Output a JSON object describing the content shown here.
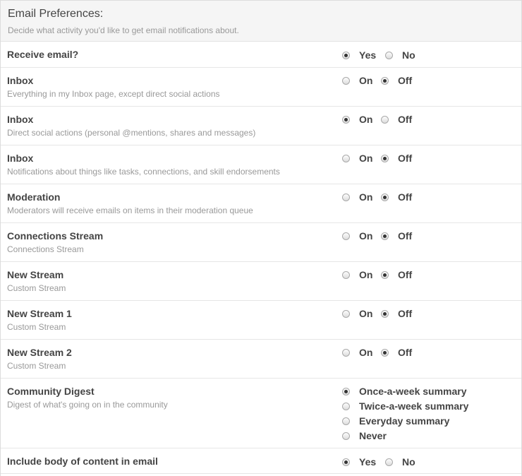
{
  "header": {
    "title": "Email Preferences:",
    "subtitle": "Decide what activity you'd like to get email notifications about."
  },
  "receive_email": {
    "label": "Receive email?",
    "yes_label": "Yes",
    "no_label": "No",
    "selected": "Yes"
  },
  "rows": [
    {
      "label": "Inbox",
      "desc": "Everything in my Inbox page, except direct social actions",
      "on_label": "On",
      "off_label": "Off",
      "selected": "Off"
    },
    {
      "label": "Inbox",
      "desc": "Direct social actions (personal @mentions, shares and messages)",
      "on_label": "On",
      "off_label": "Off",
      "selected": "On"
    },
    {
      "label": "Inbox",
      "desc": "Notifications about things like tasks, connections, and skill endorsements",
      "on_label": "On",
      "off_label": "Off",
      "selected": "Off"
    },
    {
      "label": "Moderation",
      "desc": "Moderators will receive emails on items in their moderation queue",
      "on_label": "On",
      "off_label": "Off",
      "selected": "Off"
    },
    {
      "label": "Connections Stream",
      "desc": "Connections Stream",
      "on_label": "On",
      "off_label": "Off",
      "selected": "Off"
    },
    {
      "label": "New Stream",
      "desc": "Custom Stream",
      "on_label": "On",
      "off_label": "Off",
      "selected": "Off"
    },
    {
      "label": "New Stream 1",
      "desc": "Custom Stream",
      "on_label": "On",
      "off_label": "Off",
      "selected": "Off"
    },
    {
      "label": "New Stream 2",
      "desc": "Custom Stream",
      "on_label": "On",
      "off_label": "Off",
      "selected": "Off"
    }
  ],
  "digest": {
    "label": "Community Digest",
    "desc": "Digest of what's going on in the community",
    "options": [
      "Once-a-week summary",
      "Twice-a-week summary",
      "Everyday summary",
      "Never"
    ],
    "selected": "Once-a-week summary"
  },
  "include_body": {
    "label": "Include body of content in email",
    "yes_label": "Yes",
    "no_label": "No",
    "selected": "Yes"
  }
}
